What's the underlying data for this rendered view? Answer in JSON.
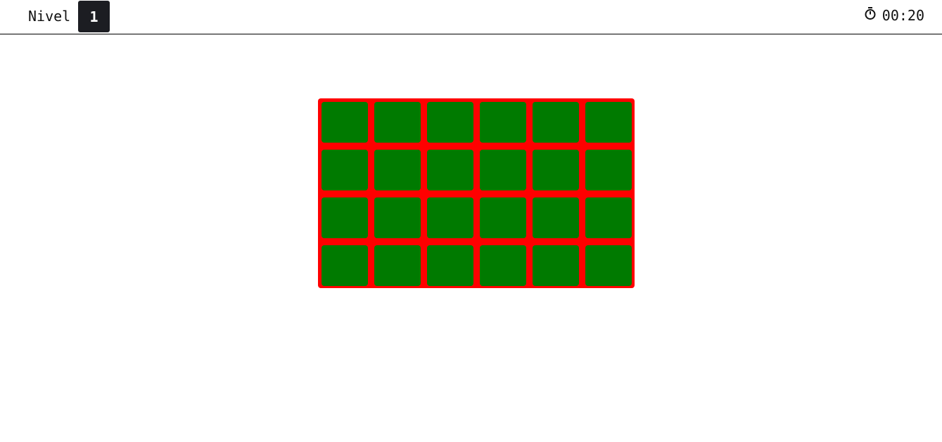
{
  "header": {
    "level_label": "Nivel",
    "level_value": "1",
    "timer_icon": "stopwatch-icon",
    "timer_value": "00:20"
  },
  "board": {
    "rows": 4,
    "columns": 6,
    "frame_color": "#ff0000",
    "tile_color": "#007a00",
    "tiles": [
      {
        "row": 1,
        "col": 1
      },
      {
        "row": 1,
        "col": 2
      },
      {
        "row": 1,
        "col": 3
      },
      {
        "row": 1,
        "col": 4
      },
      {
        "row": 1,
        "col": 5
      },
      {
        "row": 1,
        "col": 6
      },
      {
        "row": 2,
        "col": 1
      },
      {
        "row": 2,
        "col": 2
      },
      {
        "row": 2,
        "col": 3
      },
      {
        "row": 2,
        "col": 4
      },
      {
        "row": 2,
        "col": 5
      },
      {
        "row": 2,
        "col": 6
      },
      {
        "row": 3,
        "col": 1
      },
      {
        "row": 3,
        "col": 2
      },
      {
        "row": 3,
        "col": 3
      },
      {
        "row": 3,
        "col": 4
      },
      {
        "row": 3,
        "col": 5
      },
      {
        "row": 3,
        "col": 6
      },
      {
        "row": 4,
        "col": 1
      },
      {
        "row": 4,
        "col": 2
      },
      {
        "row": 4,
        "col": 3
      },
      {
        "row": 4,
        "col": 4
      },
      {
        "row": 4,
        "col": 5
      },
      {
        "row": 4,
        "col": 6
      }
    ]
  }
}
